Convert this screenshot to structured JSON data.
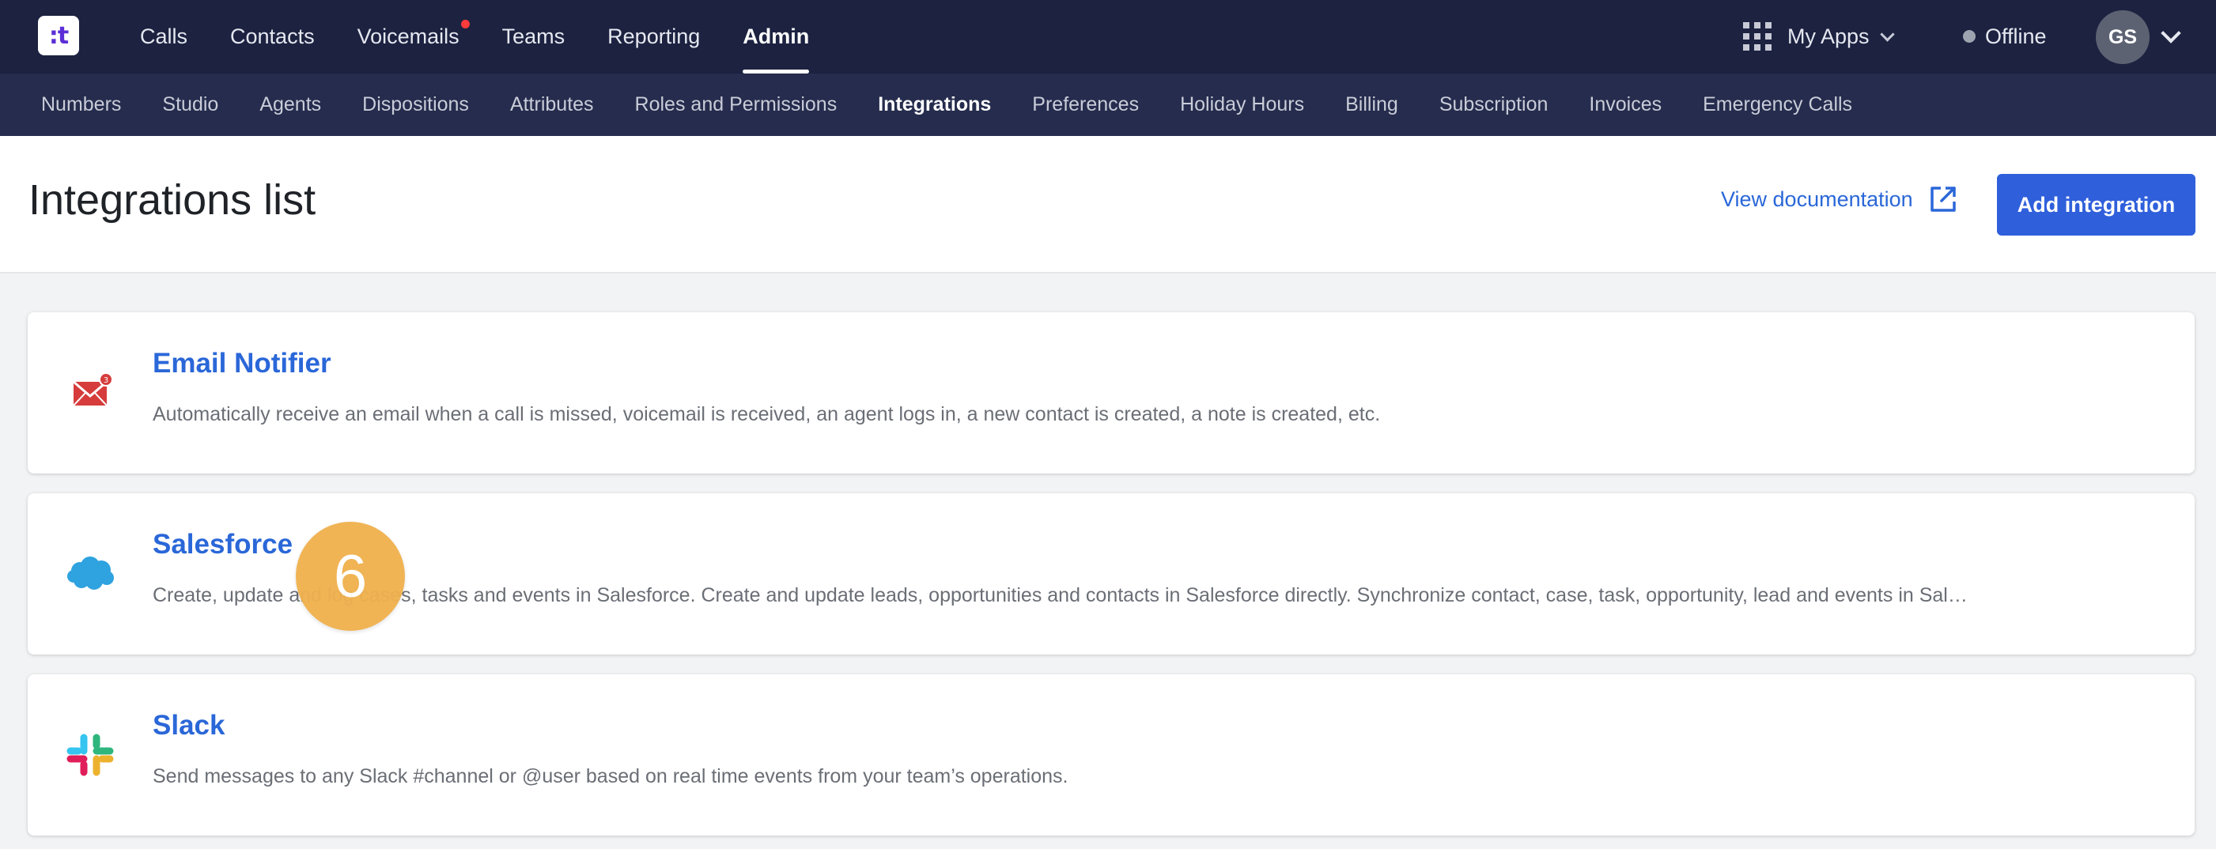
{
  "nav": {
    "logo_text": ":t",
    "items": [
      {
        "label": "Calls",
        "active": false
      },
      {
        "label": "Contacts",
        "active": false
      },
      {
        "label": "Voicemails",
        "active": false,
        "notification": true
      },
      {
        "label": "Teams",
        "active": false
      },
      {
        "label": "Reporting",
        "active": false
      },
      {
        "label": "Admin",
        "active": true
      }
    ],
    "my_apps_label": "My Apps",
    "status_label": "Offline",
    "avatar_initials": "GS"
  },
  "subnav": {
    "items": [
      {
        "label": "Numbers",
        "active": false
      },
      {
        "label": "Studio",
        "active": false
      },
      {
        "label": "Agents",
        "active": false
      },
      {
        "label": "Dispositions",
        "active": false
      },
      {
        "label": "Attributes",
        "active": false
      },
      {
        "label": "Roles and Permissions",
        "active": false
      },
      {
        "label": "Integrations",
        "active": true
      },
      {
        "label": "Preferences",
        "active": false
      },
      {
        "label": "Holiday Hours",
        "active": false
      },
      {
        "label": "Billing",
        "active": false
      },
      {
        "label": "Subscription",
        "active": false
      },
      {
        "label": "Invoices",
        "active": false
      },
      {
        "label": "Emergency Calls",
        "active": false
      }
    ]
  },
  "header": {
    "title": "Integrations list",
    "view_doc_label": "View documentation",
    "add_button_label": "Add integration"
  },
  "integrations": [
    {
      "name": "Email Notifier",
      "icon": "email-notifier-icon",
      "description": "Automatically receive an email when a call is missed, voicemail is received, an agent logs in, a new contact is created, a note is created, etc."
    },
    {
      "name": "Salesforce",
      "icon": "salesforce-icon",
      "description": "Create, update and log cases, tasks and events in Salesforce. Create and update leads, opportunities and contacts in Salesforce directly. Synchronize contact, case, task, opportunity, lead and events in Salesforce."
    },
    {
      "name": "Slack",
      "icon": "slack-icon",
      "description": "Send messages to any Slack #channel or @user based on real time events from your team’s operations."
    }
  ],
  "step_badge": "6",
  "colors": {
    "nav_bg": "#1c2240",
    "subnav_bg": "#252c4d",
    "accent": "#2f5fdb",
    "link": "#2a67d8",
    "badge": "#f0b14f"
  }
}
